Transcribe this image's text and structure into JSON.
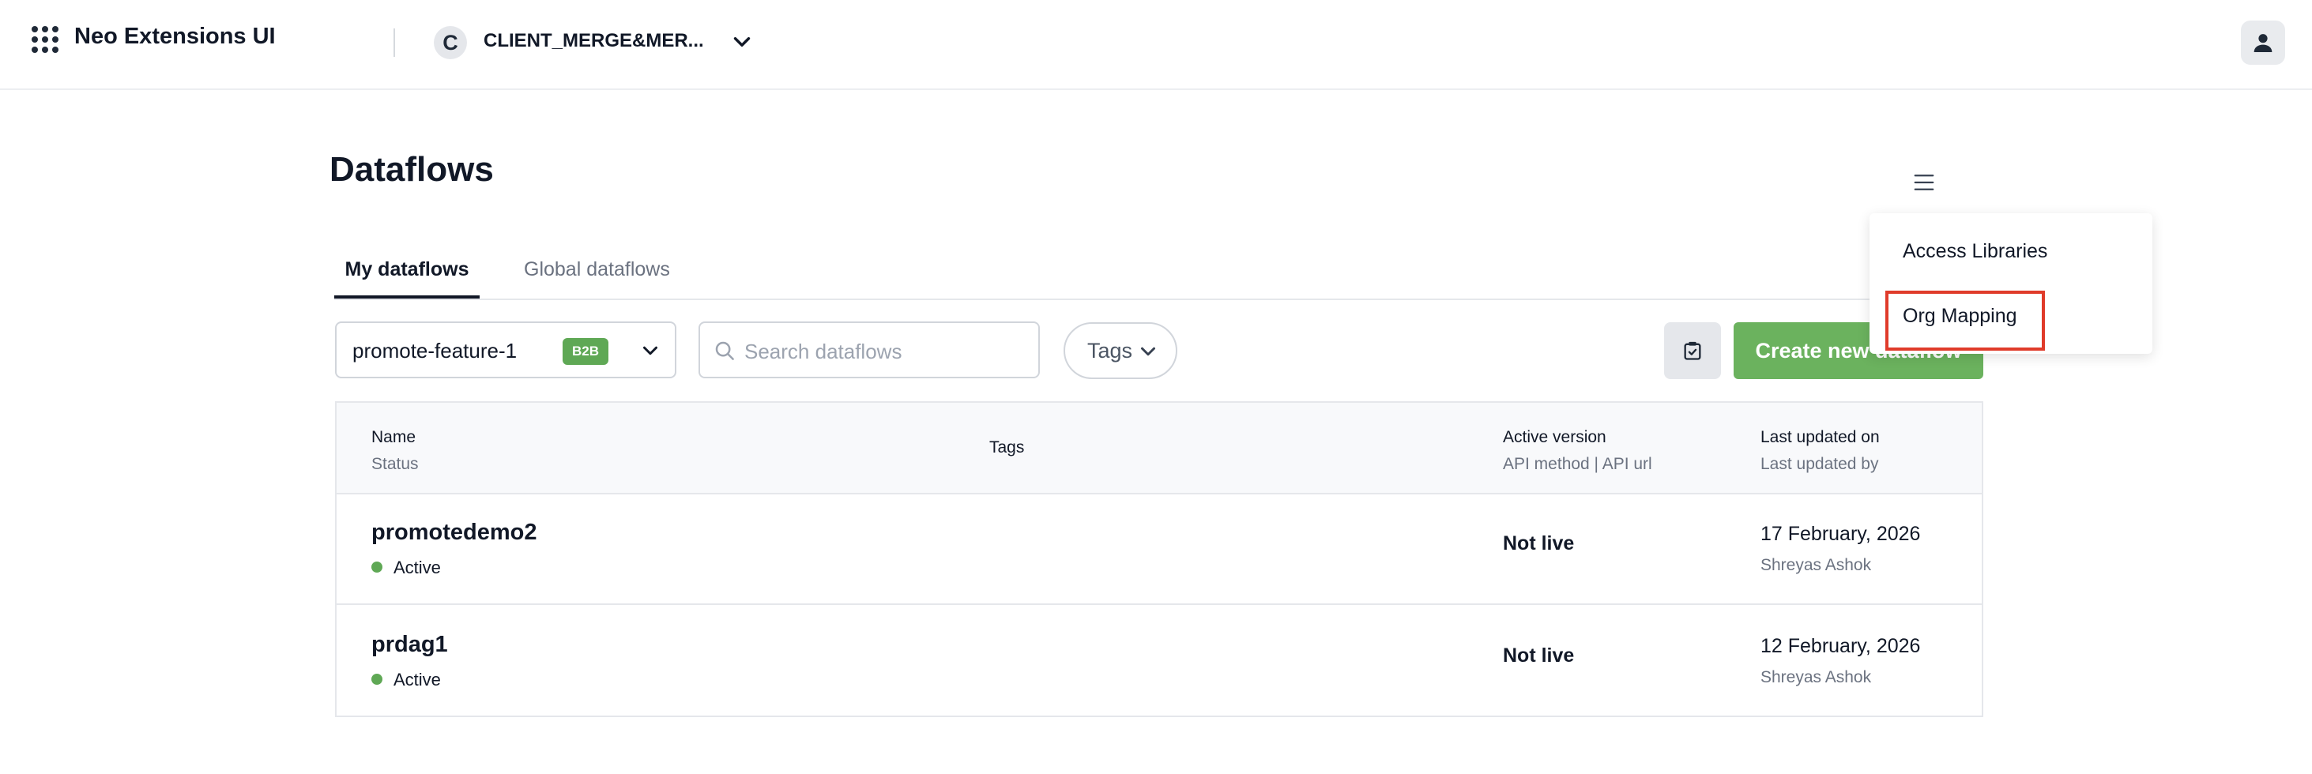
{
  "header": {
    "app_title": "Neo Extensions UI",
    "org_initial": "C",
    "org_name": "CLIENT_MERGE&MER..."
  },
  "page": {
    "title": "Dataflows"
  },
  "tabs": [
    {
      "label": "My dataflows",
      "active": true
    },
    {
      "label": "Global dataflows",
      "active": false
    }
  ],
  "filters": {
    "branch": "promote-feature-1",
    "branch_badge": "B2B",
    "search_placeholder": "Search dataflows",
    "tags_label": "Tags",
    "create_label": "Create new dataflow"
  },
  "table": {
    "columns": {
      "name": "Name",
      "status": "Status",
      "tags": "Tags",
      "active_version": "Active version",
      "api": "API method | API url",
      "last_updated_on": "Last updated on",
      "last_updated_by": "Last updated by"
    },
    "rows": [
      {
        "name": "promotedemo2",
        "status": "Active",
        "version": "Not live",
        "date": "17 February, 2026",
        "by": "Shreyas Ashok"
      },
      {
        "name": "prdag1",
        "status": "Active",
        "version": "Not live",
        "date": "12 February, 2026",
        "by": "Shreyas Ashok"
      }
    ]
  },
  "menu": {
    "items": [
      {
        "label": "Access Libraries"
      },
      {
        "label": "Org Mapping"
      }
    ]
  },
  "colors": {
    "accent_green": "#6bb25e",
    "status_active": "#5fa855",
    "highlight_red": "#e03b2a"
  }
}
